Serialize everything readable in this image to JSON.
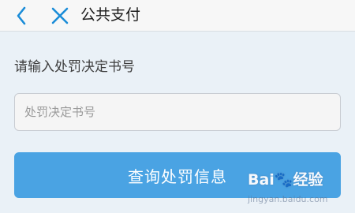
{
  "header": {
    "back_icon": "chevron-left-icon",
    "close_icon": "close-icon",
    "title": "公共支付",
    "icon_color": "#1a8cd8"
  },
  "form": {
    "label": "请输入处罚决定书号",
    "input_placeholder": "处罚决定书号",
    "input_value": "",
    "submit_label": "查询处罚信息",
    "submit_color": "#4aa3e3"
  },
  "watermark": {
    "brand": "Bai🐾经验",
    "url": "jingyan.baidu.com"
  }
}
